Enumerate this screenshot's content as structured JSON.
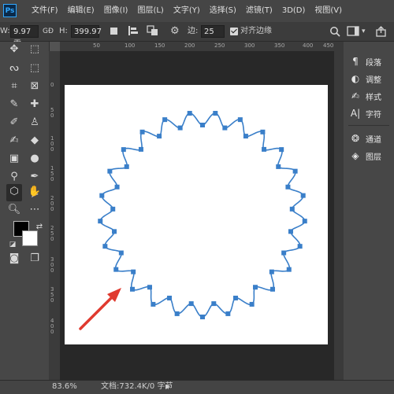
{
  "menubar": {
    "app_icon": "Ps",
    "items": [
      "文件(F)",
      "编辑(E)",
      "图像(I)",
      "图层(L)",
      "文字(Y)",
      "选择(S)",
      "滤镜(T)",
      "3D(D)",
      "视图(V)"
    ]
  },
  "options": {
    "w_label": "W:",
    "w_value": "9.97 雹",
    "link_icon": "GĐ",
    "h_label": "H:",
    "h_value": "399.97",
    "edge_label": "边:",
    "edge_value": "25",
    "align_label": "对齐边缘",
    "align_checked": true
  },
  "ruler": {
    "top_labels": [
      "50",
      "100",
      "150",
      "200",
      "250",
      "300",
      "350",
      "400",
      "450"
    ],
    "left_labels": [
      "0",
      "50",
      "100",
      "150",
      "200",
      "250",
      "300",
      "350",
      "400"
    ]
  },
  "panels": [
    {
      "icon": "paragraph-icon",
      "label": "段落"
    },
    {
      "icon": "adjustments-icon",
      "label": "调整"
    },
    {
      "icon": "styles-icon",
      "label": "样式"
    },
    {
      "icon": "character-icon",
      "label": "字符"
    },
    {
      "icon": "channels-icon",
      "label": "通道"
    },
    {
      "icon": "layers-icon",
      "label": "图层"
    }
  ],
  "status": {
    "zoom": "83.6%",
    "doc": "文档:732.4K/0 字节"
  },
  "shape": {
    "stroke_color": "#3a7fc9",
    "anchor_color": "#3a7fc9",
    "arrow_color": "#e03a2f"
  }
}
